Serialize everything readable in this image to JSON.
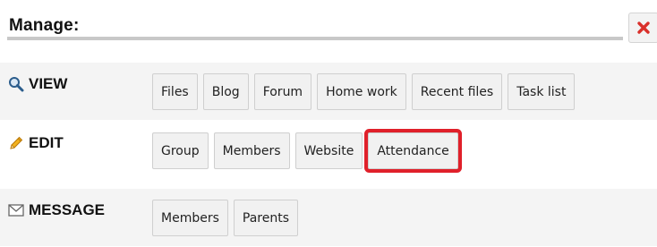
{
  "header": {
    "title": "Manage:",
    "close_icon": "close-x-icon",
    "accent": "#d9302b"
  },
  "sections": {
    "view": {
      "label": "VIEW",
      "icon": "magnifier-icon",
      "buttons": [
        "Files",
        "Blog",
        "Forum",
        "Home work",
        "Recent files",
        "Task list"
      ]
    },
    "edit": {
      "label": "EDIT",
      "icon": "pencil-icon",
      "buttons": [
        "Group",
        "Members",
        "Website",
        "Attendance"
      ],
      "highlighted_button": "Attendance",
      "highlight_color": "#e0202a"
    },
    "message": {
      "label": "MESSAGE",
      "icon": "envelope-icon",
      "buttons": [
        "Members",
        "Parents"
      ]
    }
  }
}
